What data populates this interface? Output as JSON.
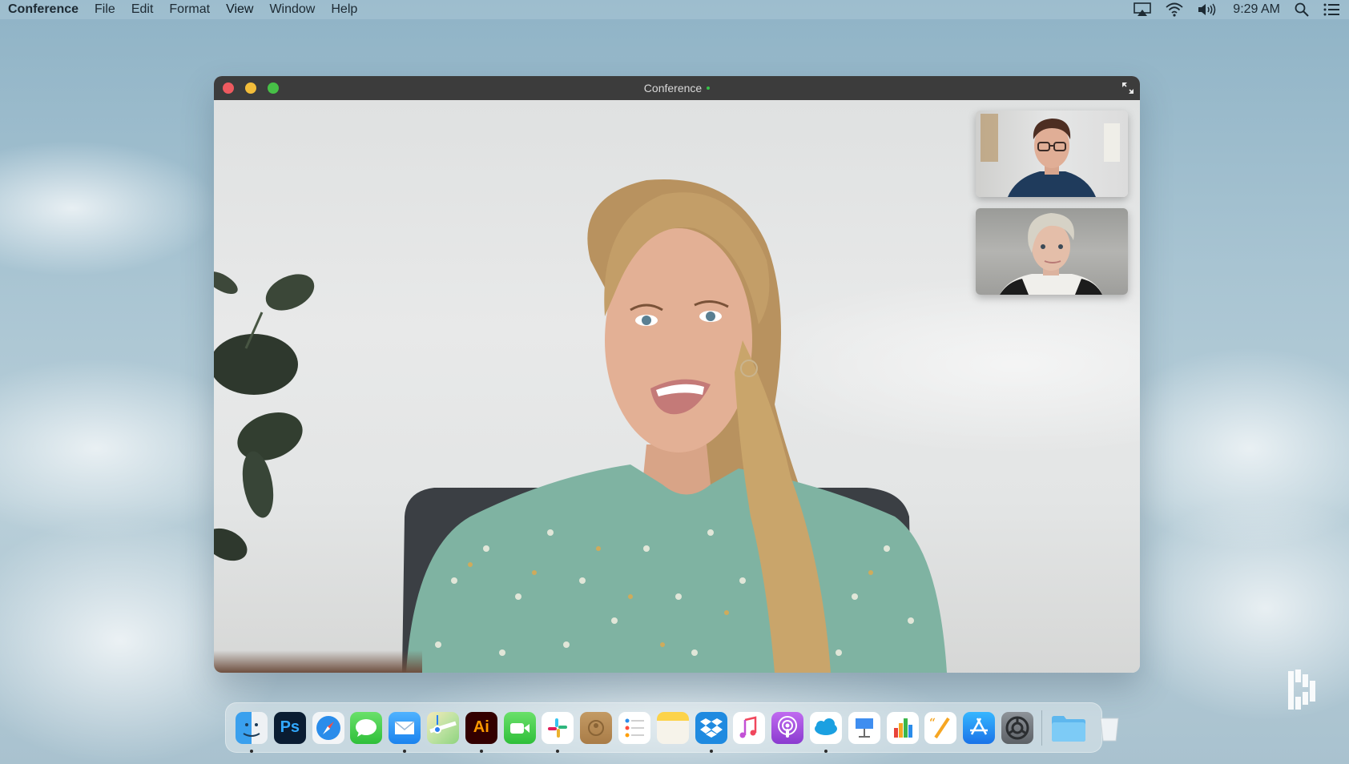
{
  "menubar": {
    "app_name": "Conference",
    "items": [
      "File",
      "Edit",
      "Format",
      "View",
      "Window",
      "Help"
    ],
    "status_icons": [
      "airplay-icon",
      "wifi-icon",
      "volume-icon"
    ],
    "clock": "9:29 AM",
    "right_icons": [
      "spotlight-search-icon",
      "notification-center-icon"
    ]
  },
  "window": {
    "title": "Conference",
    "recording_indicator_color": "#36c24a",
    "traffic_lights": [
      "close",
      "minimize",
      "zoom"
    ],
    "main_video": {
      "speaker": "Active speaker (woman in floral blouse)"
    },
    "participants": [
      {
        "label": "Participant 1 (man with glasses)"
      },
      {
        "label": "Participant 2 (woman with short blonde hair)"
      }
    ]
  },
  "dock": {
    "apps": [
      {
        "name": "Finder",
        "icon": "finder-icon",
        "running": true
      },
      {
        "name": "Photoshop",
        "icon": "photoshop-icon",
        "label": "Ps",
        "running": false
      },
      {
        "name": "Safari",
        "icon": "safari-icon",
        "running": false
      },
      {
        "name": "Messages",
        "icon": "messages-icon",
        "running": false
      },
      {
        "name": "Mail",
        "icon": "mail-icon",
        "running": true
      },
      {
        "name": "Maps",
        "icon": "maps-icon",
        "running": false
      },
      {
        "name": "Illustrator",
        "icon": "illustrator-icon",
        "label": "Ai",
        "running": true
      },
      {
        "name": "FaceTime",
        "icon": "facetime-icon",
        "running": false
      },
      {
        "name": "Slack",
        "icon": "slack-icon",
        "running": true
      },
      {
        "name": "Contacts",
        "icon": "contacts-icon",
        "running": false
      },
      {
        "name": "Reminders",
        "icon": "reminders-icon",
        "running": false
      },
      {
        "name": "Notes",
        "icon": "notes-icon",
        "running": false
      },
      {
        "name": "Dropbox",
        "icon": "dropbox-icon",
        "running": true
      },
      {
        "name": "Music",
        "icon": "music-icon",
        "running": false
      },
      {
        "name": "Podcasts",
        "icon": "podcasts-icon",
        "running": false
      },
      {
        "name": "Salesforce",
        "icon": "salesforce-icon",
        "running": true
      },
      {
        "name": "Keynote",
        "icon": "keynote-icon",
        "running": false
      },
      {
        "name": "Numbers",
        "icon": "numbers-icon",
        "running": false
      },
      {
        "name": "Pages",
        "icon": "pages-icon",
        "running": false
      },
      {
        "name": "App Store",
        "icon": "app-store-icon",
        "running": false
      },
      {
        "name": "System Preferences",
        "icon": "system-preferences-icon",
        "running": false
      }
    ],
    "extras": [
      {
        "name": "Folder",
        "icon": "folder-icon"
      },
      {
        "name": "Trash",
        "icon": "trash-icon"
      }
    ]
  },
  "watermark": {
    "icon": "brand-logo-icon"
  }
}
